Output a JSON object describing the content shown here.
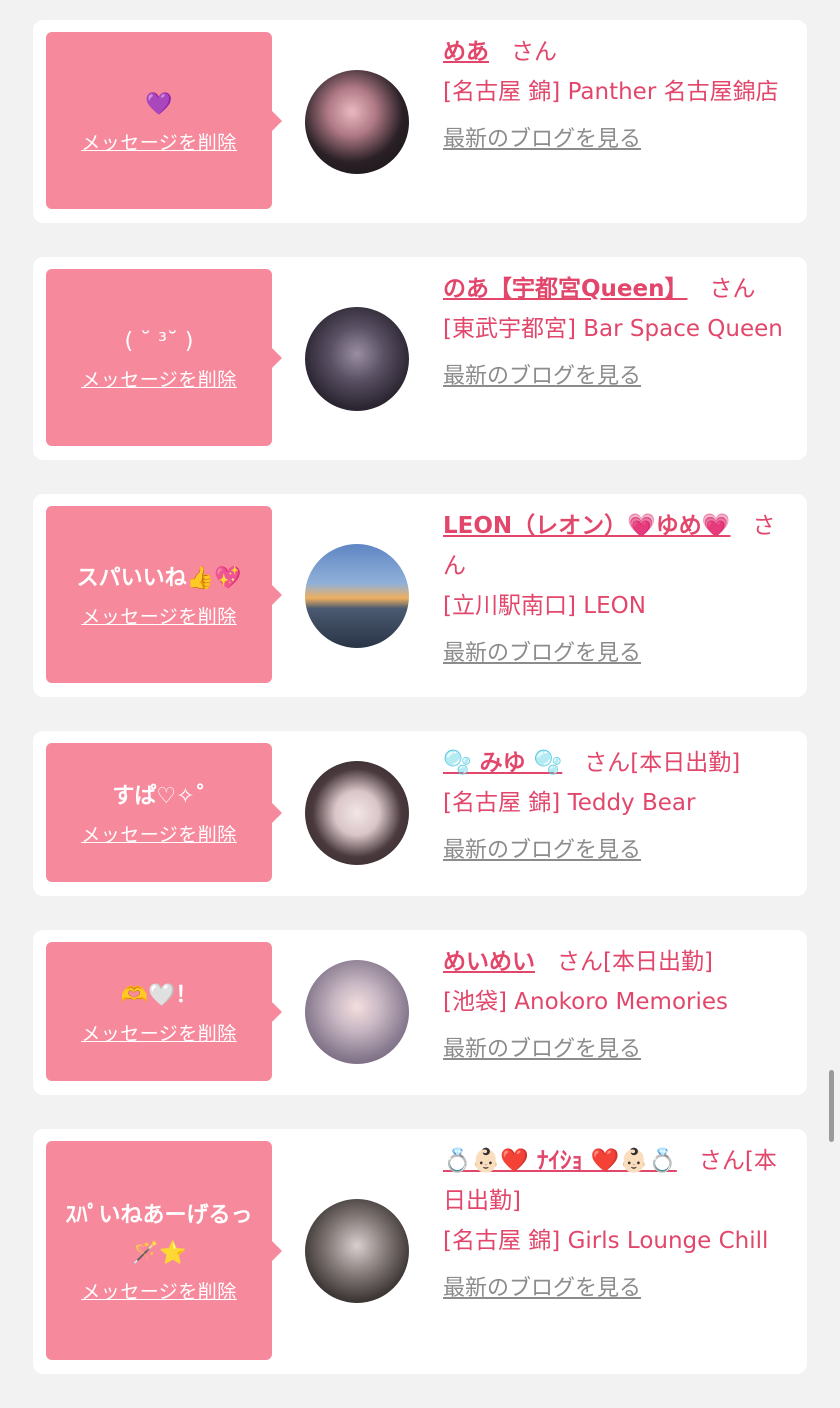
{
  "delete_label": "メッセージを削除",
  "blog_label": "最新のブログを見る",
  "san_label": "さん",
  "cards": [
    {
      "message": "💜",
      "name": "めあ",
      "extra": "",
      "shop": "[名古屋 錦] Panther 名古屋錦店"
    },
    {
      "message": "( ˘ ³˘ )",
      "name": "のあ【宇都宮Queen】",
      "extra": "",
      "shop": "[東武宇都宮] Bar Space Queen"
    },
    {
      "message": "スパいいね👍💖",
      "name": "LEON（レオン）💗ゆめ💗",
      "extra": "",
      "shop": "[立川駅南口] LEON"
    },
    {
      "message": "すぱ♡✧˚",
      "name": "🫧 みゆ 🫧",
      "extra": "[本日出勤]",
      "shop": "[名古屋 錦] Teddy Bear"
    },
    {
      "message": "🫶🤍！",
      "name": "めいめい",
      "extra": "[本日出勤]",
      "shop": "[池袋] Anokoro Memories"
    },
    {
      "message": "ｽﾊﾟいねあーげるっ🪄⭐",
      "name": "💍👶🏻❤️ ﾅｲｼｮ ❤️👶🏻💍",
      "extra": "[本日出勤]",
      "shop": "[名古屋 錦] Girls Lounge Chill"
    }
  ]
}
